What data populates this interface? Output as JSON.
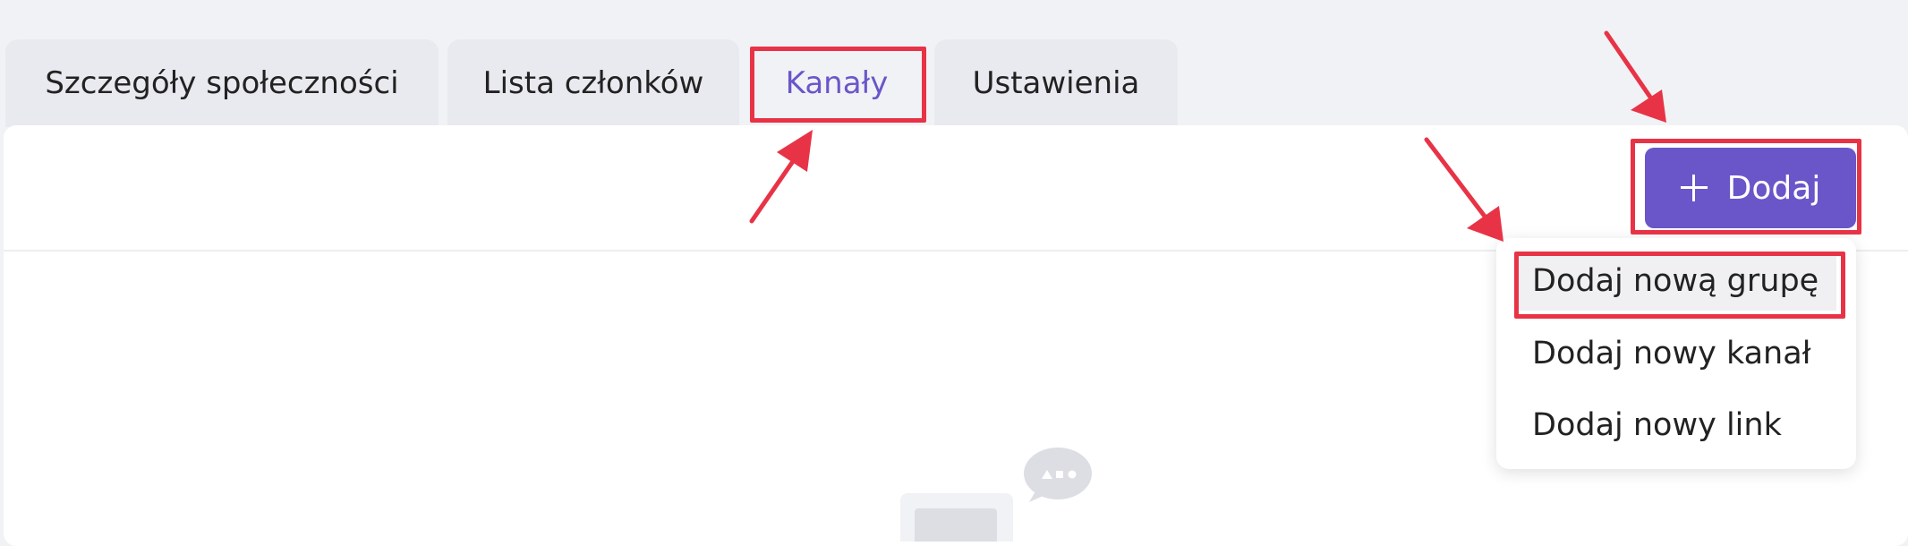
{
  "tabs": [
    {
      "label": "Szczegóły społeczności",
      "active": false
    },
    {
      "label": "Lista członków",
      "active": false
    },
    {
      "label": "Kanały",
      "active": true
    },
    {
      "label": "Ustawienia",
      "active": false
    }
  ],
  "toolbar": {
    "add_label": "Dodaj",
    "add_icon": "plus-icon"
  },
  "dropdown": {
    "items": [
      {
        "label": "Dodaj nową grupę"
      },
      {
        "label": "Dodaj nowy kanał"
      },
      {
        "label": "Dodaj nowy link"
      }
    ]
  },
  "colors": {
    "accent": "#6a56c9",
    "annotation": "#e83346",
    "page_bg": "#f1f2f6",
    "panel_bg": "#ffffff"
  }
}
